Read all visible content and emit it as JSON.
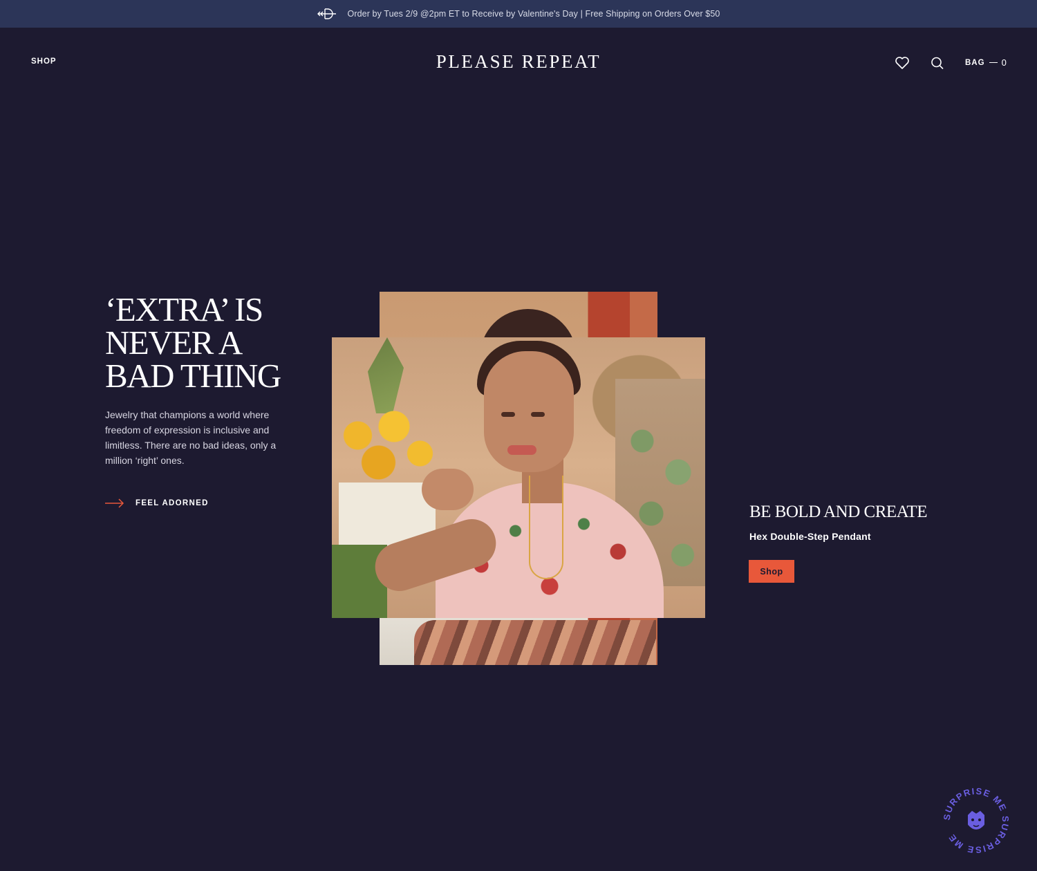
{
  "announcement": {
    "icon": "arrow-logo-icon",
    "text": "Order by Tues 2/9 @2pm ET to Receive by Valentine's Day | Free Shipping on Orders Over $50"
  },
  "header": {
    "shop_label": "SHOP",
    "logo": "PLEASE REPEAT",
    "wishlist_icon": "heart-icon",
    "search_icon": "search-icon",
    "bag_label": "BAG",
    "bag_count": "0"
  },
  "hero": {
    "headline_lines": [
      "‘EXTRA’ IS",
      "NEVER A",
      "BAD THING"
    ],
    "body": "Jewelry that champions a world where freedom of expression is inclusive and limitless. There are no bad ideas, only a million ‘right’ ones.",
    "cta_label": "FEEL ADORNED",
    "cta_icon": "arrow-right-icon"
  },
  "promo": {
    "title": "BE BOLD AND CREATE",
    "product": "Hex Double-Step Pendant",
    "button_label": "Shop"
  },
  "badge": {
    "text": "SURPRISE ME SURPRISE ME",
    "icon": "crest-face-icon"
  },
  "colors": {
    "background": "#1d1a30",
    "announcement_bg": "#2c3558",
    "accent": "#e8583a",
    "badge": "#6a5ee0"
  }
}
